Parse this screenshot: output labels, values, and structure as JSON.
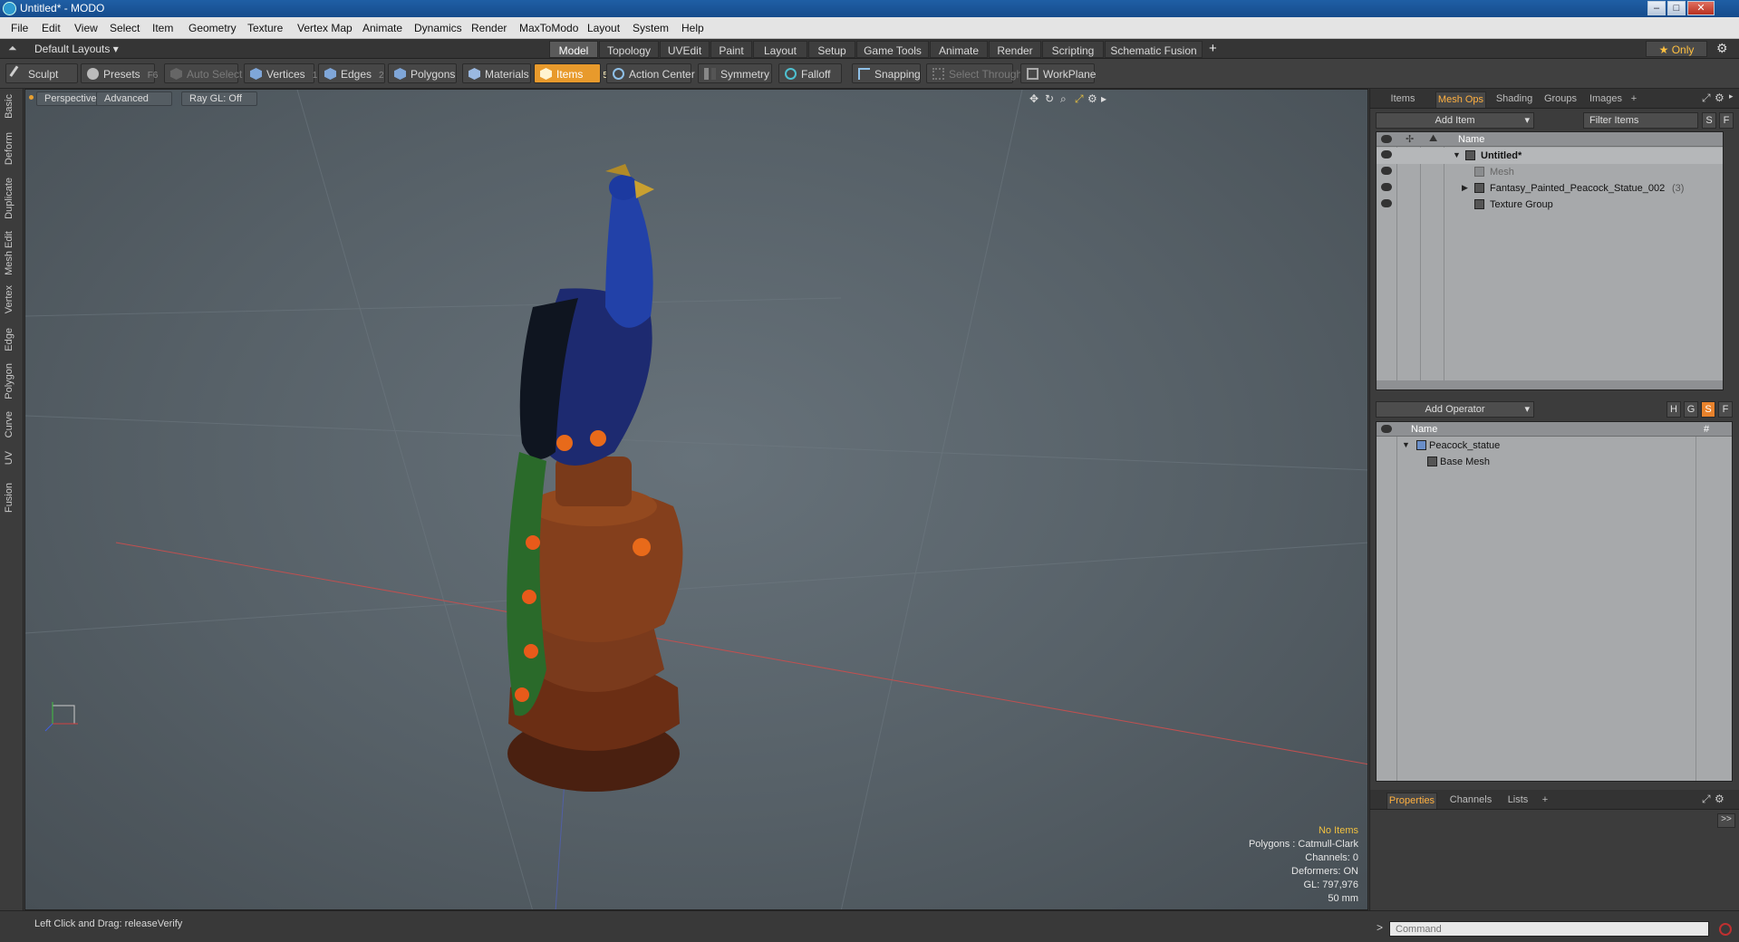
{
  "window": {
    "title": "Untitled* - MODO"
  },
  "menu": [
    "File",
    "Edit",
    "View",
    "Select",
    "Item",
    "Geometry",
    "Texture",
    "Vertex Map",
    "Animate",
    "Dynamics",
    "Render",
    "MaxToModo",
    "Layout",
    "System",
    "Help"
  ],
  "layout_bar": {
    "layout_name": "Default Layouts ▾",
    "tabs": [
      "Model",
      "Topology",
      "UVEdit",
      "Paint",
      "Layout",
      "Setup",
      "Game Tools",
      "Animate",
      "Render",
      "Scripting",
      "Schematic Fusion"
    ],
    "active_tab": "Model",
    "add_tab": "+",
    "only_label": "★ Only"
  },
  "toolbar": {
    "sculpt": "Sculpt",
    "presets": "Presets",
    "presets_hotkey": "F6",
    "auto_select": "Auto Select",
    "vertices": "Vertices",
    "vertices_hotkey": "1",
    "edges": "Edges",
    "edges_hotkey": "2",
    "polygons": "Polygons",
    "materials": "Materials",
    "items": "Items",
    "items_hotkey": "5",
    "action_center": "Action Center",
    "symmetry": "Symmetry",
    "falloff": "Falloff",
    "snapping": "Snapping",
    "select_through": "Select Through",
    "workplane": "WorkPlane"
  },
  "left_tabs": [
    "Basic",
    "Deform",
    "Duplicate",
    "Mesh Edit",
    "Vertex",
    "Edge",
    "Polygon",
    "Curve",
    "UV",
    "Fusion"
  ],
  "viewport": {
    "perspective": "Perspective",
    "advanced": "Advanced",
    "raygl": "Ray GL: Off",
    "info": {
      "no_items": "No Items",
      "polygons": "Polygons : Catmull-Clark",
      "channels": "Channels: 0",
      "deformers": "Deformers: ON",
      "gl": "GL: 797,976",
      "focal": "50 mm"
    }
  },
  "scene_panel": {
    "tabs": [
      "Items",
      "Mesh Ops",
      "Shading",
      "Groups",
      "Images",
      "+"
    ],
    "active_tab": "Mesh Ops",
    "add_item": "Add Item",
    "filter_items": "Filter Items",
    "filter_s": "S",
    "filter_f": "F",
    "column_name": "Name",
    "items": [
      {
        "name": "Untitled*"
      },
      {
        "name": "Mesh"
      },
      {
        "name": "Fantasy_Painted_Peacock_Statue_002",
        "count": "(3)"
      },
      {
        "name": "Texture Group"
      }
    ]
  },
  "operator_panel": {
    "add_operator": "Add Operator",
    "buttons": [
      "H",
      "G",
      "S",
      "F"
    ],
    "column_name": "Name",
    "column_hash": "#",
    "items": [
      {
        "name": "Peacock_statue"
      },
      {
        "name": "Base Mesh"
      }
    ]
  },
  "properties_panel": {
    "tabs": [
      "Properties",
      "Channels",
      "Lists",
      "+"
    ],
    "active_tab": "Properties",
    "expand": ">>"
  },
  "status": {
    "message": "Left Click and Drag:  releaseVerify"
  },
  "command": {
    "placeholder": "Command"
  }
}
